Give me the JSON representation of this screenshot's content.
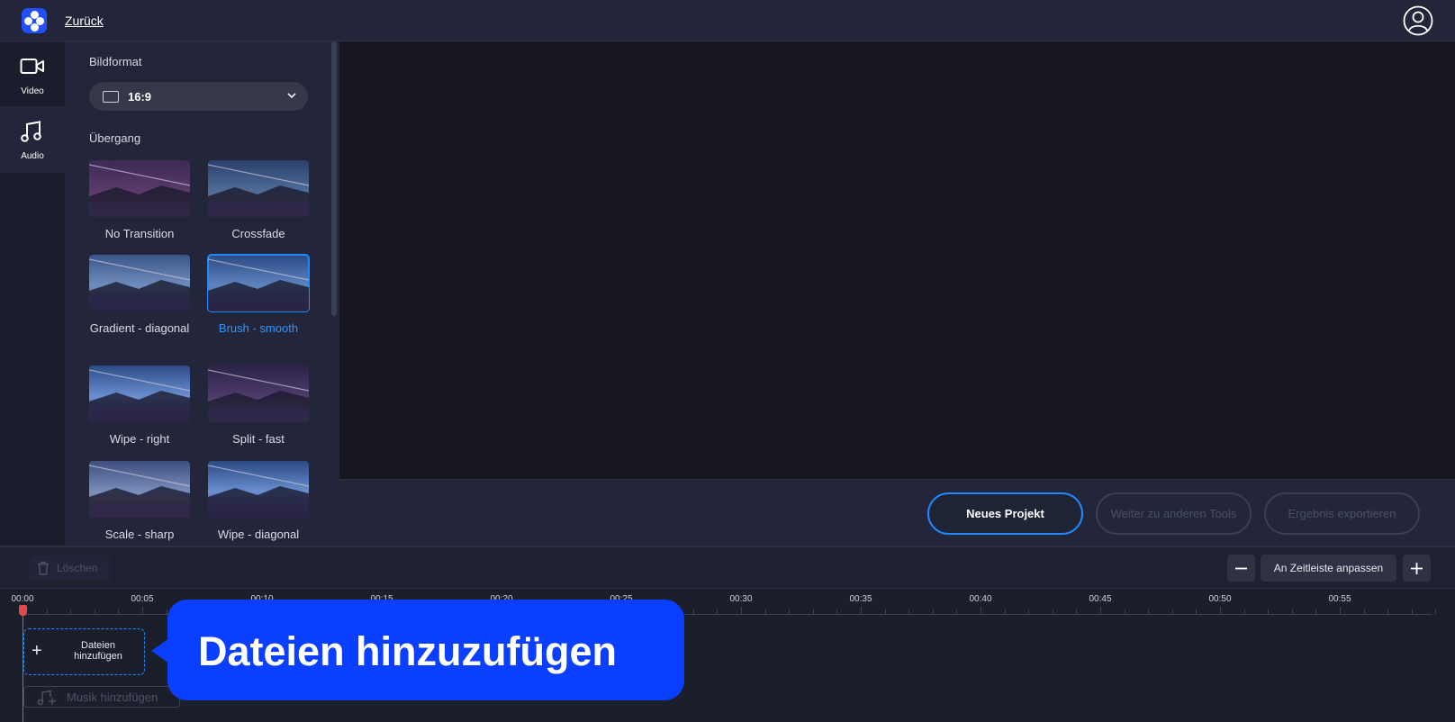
{
  "header": {
    "back_label": "Zurück",
    "logo_icon": "app-logo-icon",
    "account_icon": "user-circle-icon"
  },
  "rail": {
    "items": [
      {
        "label": "Video",
        "icon": "video-camera-icon",
        "active": true
      },
      {
        "label": "Audio",
        "icon": "music-note-icon",
        "active": false
      }
    ]
  },
  "panel": {
    "format_title": "Bildformat",
    "aspect_ratio": "16:9",
    "transition_title": "Übergang",
    "transitions": [
      {
        "label": "No Transition",
        "selected": false
      },
      {
        "label": "Crossfade",
        "selected": false
      },
      {
        "label": "Gradient - diagonal",
        "selected": false
      },
      {
        "label": "Brush - smooth",
        "selected": true
      },
      {
        "label": "Wipe - right",
        "selected": false
      },
      {
        "label": "Split - fast",
        "selected": false
      },
      {
        "label": "Scale - sharp",
        "selected": false
      },
      {
        "label": "Wipe - diagonal",
        "selected": false
      }
    ]
  },
  "actions": {
    "new_project": "Neues Projekt",
    "other_tools": "Weiter zu anderen Tools",
    "export": "Ergebnis exportieren"
  },
  "timeline": {
    "delete_label": "Löschen",
    "fit_label": "An Zeitleiste anpassen",
    "ticks": [
      "00:00",
      "00:05",
      "00:10",
      "00:15",
      "00:20",
      "00:25",
      "00:30",
      "00:35",
      "00:40",
      "00:45",
      "00:50",
      "00:55"
    ],
    "add_files_label": "Dateien hinzufügen",
    "add_music_label": "Musik hinzufügen"
  },
  "callout": {
    "text": "Dateien hinzuzufügen",
    "color": "#0b3fff"
  },
  "colors": {
    "accent": "#1d8bff",
    "playhead": "#e24a4a"
  }
}
